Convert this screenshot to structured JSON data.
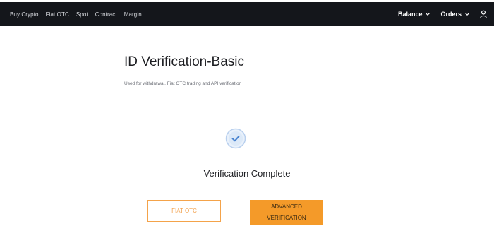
{
  "nav": {
    "left_items": [
      {
        "label": "Buy Crypto"
      },
      {
        "label": "Fiat OTC"
      },
      {
        "label": "Spot"
      },
      {
        "label": "Contract"
      },
      {
        "label": "Margin"
      }
    ],
    "balance_label": "Balance",
    "orders_label": "Orders",
    "icons": {
      "dropdown": "chevron-down-icon",
      "account": "user-icon"
    }
  },
  "main": {
    "title": "ID Verification-Basic",
    "subtitle": "Used for withdrawal, Fiat OTC trading and API verification",
    "status": "Verification Complete",
    "status_icon": "check-circle-icon",
    "fiat_otc_button": "FIAT OTC",
    "advanced_button": "ADVANCED VERIFICATION"
  },
  "colors": {
    "topbar": "#14161b",
    "accent": "#f49a29",
    "check": "#4a84d0"
  }
}
